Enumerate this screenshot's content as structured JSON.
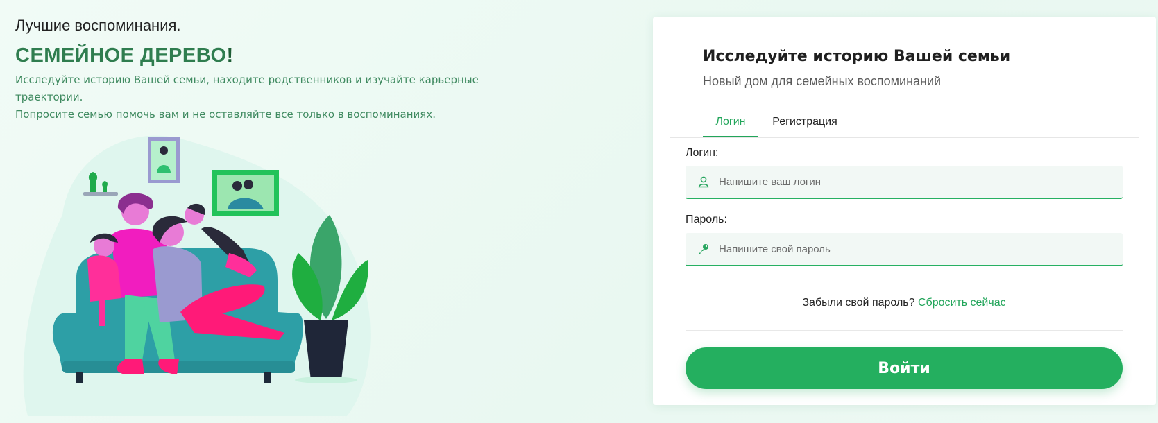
{
  "hero": {
    "tagline": "Лучшие воспоминания.",
    "brand": "СЕМЕЙНОЕ ДЕРЕВО",
    "brand_mark": "!",
    "description_line1": "Исследуйте историю Вашей семьи, находите родственников и изучайте карьерные траектории.",
    "description_line2": "Попросите семью помочь вам и не оставляйте все только в воспоминаниях."
  },
  "card": {
    "title": "Исследуйте историю Вашей семьи",
    "subtitle": "Новый дом для семейных воспоминаний",
    "tabs": [
      {
        "label": "Логин",
        "active": true
      },
      {
        "label": "Регистрация",
        "active": false
      }
    ],
    "login_field": {
      "label": "Логин:",
      "placeholder": "Напишите ваш логин",
      "value": "",
      "icon": "user-icon"
    },
    "password_field": {
      "label": "Пароль:",
      "placeholder": "Напишите свой пароль",
      "value": "",
      "icon": "key-icon"
    },
    "forgot_text": "Забыли свой пароль?",
    "reset_link": "Сбросить сейчас",
    "submit_label": "Войти"
  },
  "colors": {
    "accent": "#22a55a",
    "button": "#24af5f",
    "brand_text": "#2f7d4f",
    "background": "#eef9f4"
  }
}
